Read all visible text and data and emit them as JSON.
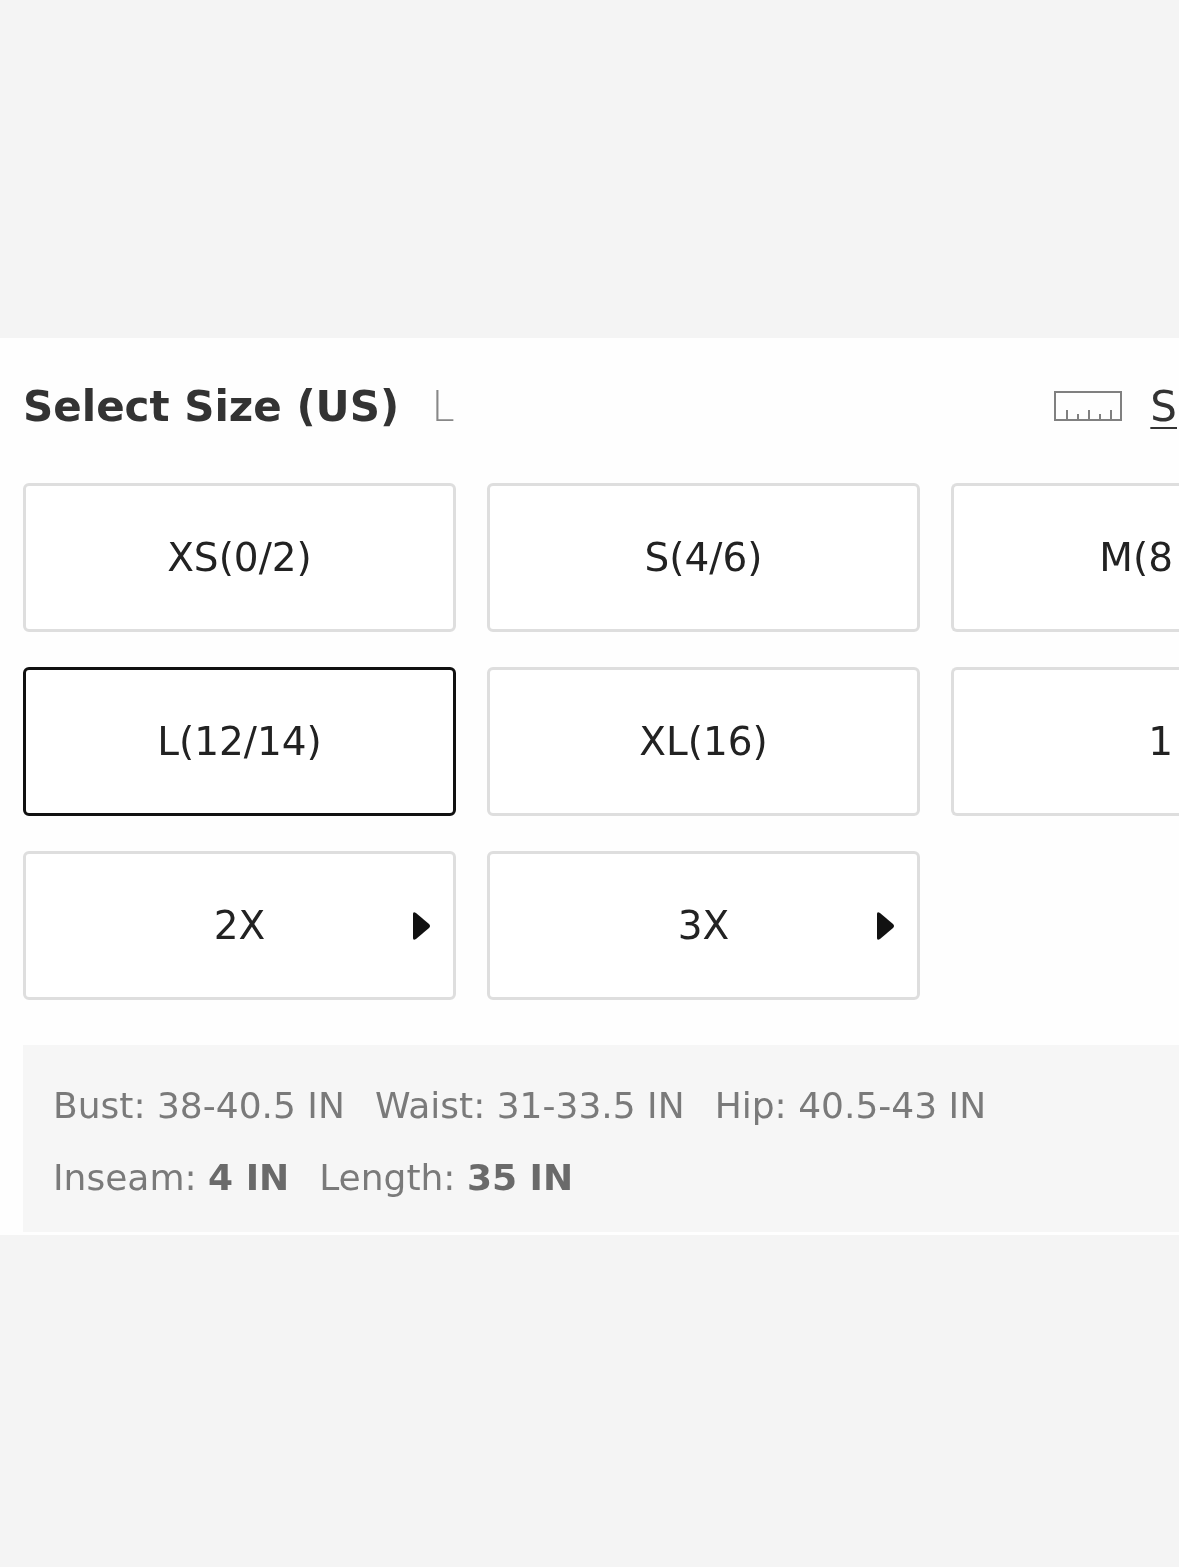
{
  "header": {
    "title": "Select Size (US)",
    "selected_size": "L",
    "size_guide_link": "S"
  },
  "sizes": [
    {
      "label": "XS(0/2)",
      "selected": false,
      "kind": "plain"
    },
    {
      "label": "S(4/6)",
      "selected": false,
      "kind": "plain"
    },
    {
      "label": "M(8",
      "selected": false,
      "kind": "plain"
    },
    {
      "label": "L(12/14)",
      "selected": true,
      "kind": "plain"
    },
    {
      "label": "XL(16)",
      "selected": false,
      "kind": "plain"
    },
    {
      "label": "1",
      "selected": false,
      "kind": "plain"
    },
    {
      "label": "2X",
      "selected": false,
      "kind": "arrow"
    },
    {
      "label": "3X",
      "selected": false,
      "kind": "arrow"
    }
  ],
  "measurements": [
    [
      "Bust: 38-40.5 IN",
      "Waist: 31-33.5 IN",
      "Hip: 40.5-43 IN"
    ],
    [
      "Inseam: **4 IN**",
      "Length: **35 IN**"
    ]
  ]
}
